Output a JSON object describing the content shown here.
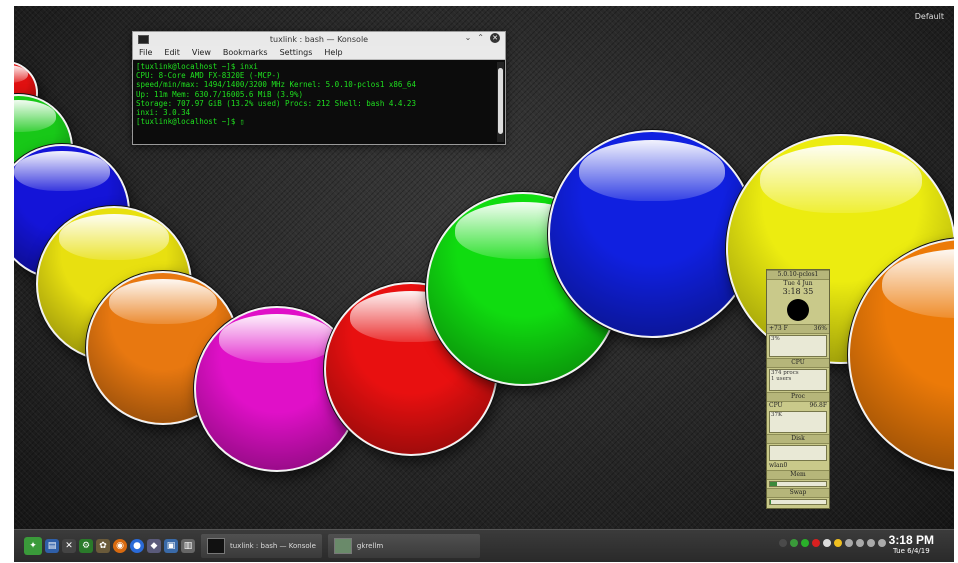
{
  "desktop": {
    "activity_label": "Default",
    "balls": [
      {
        "color": "#e01010"
      },
      {
        "color": "#18c818"
      },
      {
        "color": "#1414d8"
      },
      {
        "color": "#e8e010"
      },
      {
        "color": "#e87810"
      },
      {
        "color": "#e010c8"
      },
      {
        "color": "#e81010"
      },
      {
        "color": "#10dc10"
      },
      {
        "color": "#1020e0"
      },
      {
        "color": "#ecec10"
      },
      {
        "color": "#ec7a08"
      }
    ]
  },
  "konsole": {
    "title": "tuxlink : bash — Konsole",
    "menu": [
      "File",
      "Edit",
      "View",
      "Bookmarks",
      "Settings",
      "Help"
    ],
    "lines": [
      "[tuxlink@localhost ~]$ inxi",
      "CPU: 8-Core AMD FX-8320E (-MCP-)",
      "speed/min/max: 1494/1400/3200 MHz Kernel: 5.0.10-pclos1 x86_64",
      "Up: 11m Mem: 630.7/16005.6 MiB (3.9%)",
      "Storage: 707.97 GiB (13.2% used) Procs: 212 Shell: bash 4.4.23",
      "inxi: 3.0.34",
      "[tuxlink@localhost ~]$ ▯"
    ]
  },
  "gkrellm": {
    "host": "5.0.10-pclos1",
    "date": "Tue 4 Jun",
    "time": "3:18 35",
    "temp": "+73 F",
    "temp_pct": "36%",
    "cpu_pct": "3%",
    "cpu_label": "CPU",
    "procs": "374 procs",
    "users": "1 users",
    "proc_label": "Proc",
    "cpu2": "CPU",
    "cpu2_temp": "96.8F",
    "disk_val": "37K",
    "disk_label": "Disk",
    "net_label": "wlan0",
    "mem_label": "Mem",
    "swap_label": "Swap",
    "mem_fill": 0.12,
    "swap_fill": 0.02
  },
  "taskbar": {
    "tasks": [
      {
        "label": "tuxlink : bash — Konsole"
      },
      {
        "label": "gkrellm"
      }
    ],
    "time": "3:18 PM",
    "date": "Tue 6/4/19"
  }
}
